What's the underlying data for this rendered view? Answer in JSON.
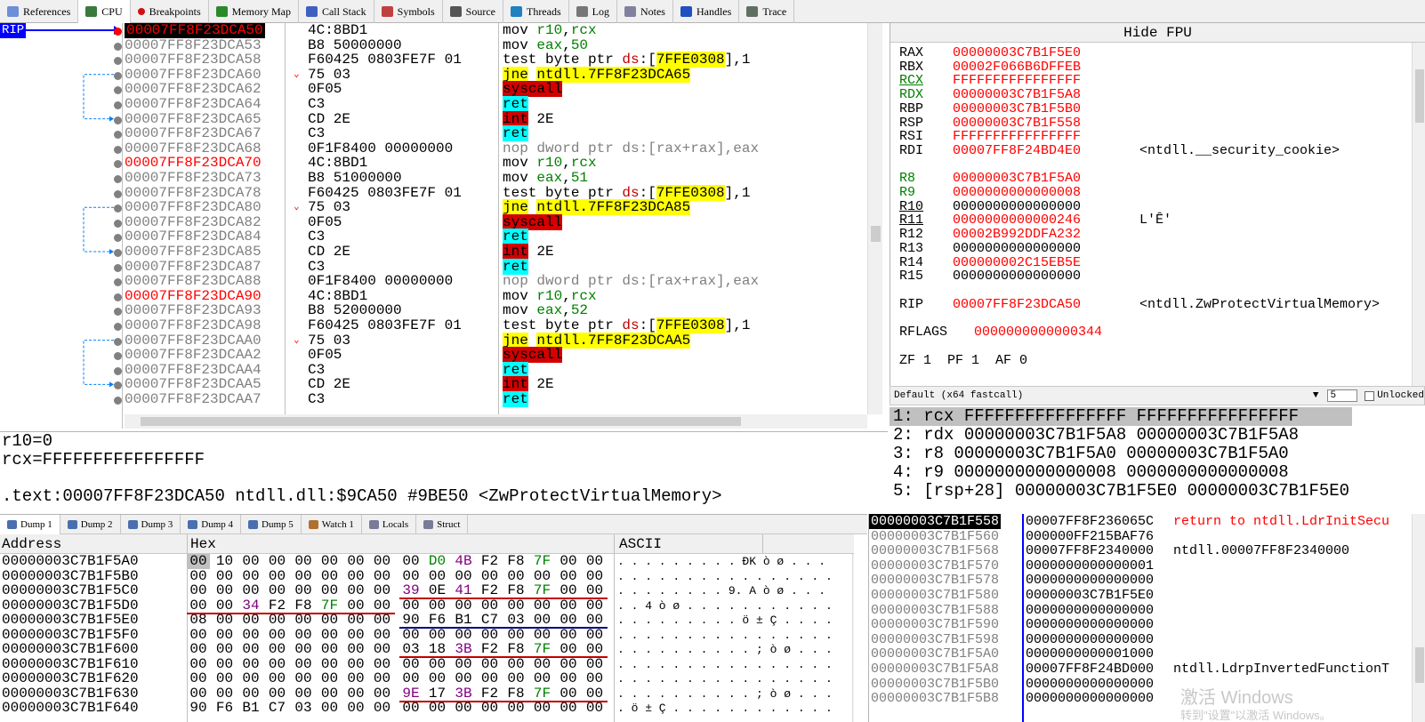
{
  "tabs": [
    {
      "label": "References",
      "icon": "search-icon"
    },
    {
      "label": "CPU",
      "icon": "cpu-icon"
    },
    {
      "label": "Breakpoints",
      "icon": "breakpoint-icon"
    },
    {
      "label": "Memory Map",
      "icon": "memory-icon"
    },
    {
      "label": "Call Stack",
      "icon": "stack-icon"
    },
    {
      "label": "Symbols",
      "icon": "symbols-icon"
    },
    {
      "label": "Source",
      "icon": "source-icon"
    },
    {
      "label": "Threads",
      "icon": "threads-icon"
    },
    {
      "label": "Log",
      "icon": "log-icon"
    },
    {
      "label": "Notes",
      "icon": "notes-icon"
    },
    {
      "label": "Handles",
      "icon": "handles-icon"
    },
    {
      "label": "Trace",
      "icon": "trace-icon"
    }
  ],
  "rip_label": "RIP",
  "disasm": [
    {
      "addr": "00007FF8F23DCA50",
      "bytes": "4C:8BD1",
      "instr": "mov r10,rcx",
      "style": "sel"
    },
    {
      "addr": "00007FF8F23DCA53",
      "bytes": "B8 50000000",
      "instr": "mov eax,50"
    },
    {
      "addr": "00007FF8F23DCA58",
      "bytes": "F60425 0803FE7F 01",
      "instr": "test byte ptr ds:[7FFE0308],1"
    },
    {
      "addr": "00007FF8F23DCA60",
      "bytes": "75 03",
      "instr": "jne ntdll.7FF8F23DCA65",
      "jmp": true
    },
    {
      "addr": "00007FF8F23DCA62",
      "bytes": "0F05",
      "instr": "syscall"
    },
    {
      "addr": "00007FF8F23DCA64",
      "bytes": "C3",
      "instr": "ret"
    },
    {
      "addr": "00007FF8F23DCA65",
      "bytes": "CD 2E",
      "instr": "int 2E"
    },
    {
      "addr": "00007FF8F23DCA67",
      "bytes": "C3",
      "instr": "ret"
    },
    {
      "addr": "00007FF8F23DCA68",
      "bytes": "0F1F8400 00000000",
      "instr": "nop dword ptr ds:[rax+rax],eax"
    },
    {
      "addr": "00007FF8F23DCA70",
      "bytes": "4C:8BD1",
      "instr": "mov r10,rcx",
      "style": "red"
    },
    {
      "addr": "00007FF8F23DCA73",
      "bytes": "B8 51000000",
      "instr": "mov eax,51"
    },
    {
      "addr": "00007FF8F23DCA78",
      "bytes": "F60425 0803FE7F 01",
      "instr": "test byte ptr ds:[7FFE0308],1"
    },
    {
      "addr": "00007FF8F23DCA80",
      "bytes": "75 03",
      "instr": "jne ntdll.7FF8F23DCA85",
      "jmp": true
    },
    {
      "addr": "00007FF8F23DCA82",
      "bytes": "0F05",
      "instr": "syscall"
    },
    {
      "addr": "00007FF8F23DCA84",
      "bytes": "C3",
      "instr": "ret"
    },
    {
      "addr": "00007FF8F23DCA85",
      "bytes": "CD 2E",
      "instr": "int 2E"
    },
    {
      "addr": "00007FF8F23DCA87",
      "bytes": "C3",
      "instr": "ret"
    },
    {
      "addr": "00007FF8F23DCA88",
      "bytes": "0F1F8400 00000000",
      "instr": "nop dword ptr ds:[rax+rax],eax"
    },
    {
      "addr": "00007FF8F23DCA90",
      "bytes": "4C:8BD1",
      "instr": "mov r10,rcx",
      "style": "red"
    },
    {
      "addr": "00007FF8F23DCA93",
      "bytes": "B8 52000000",
      "instr": "mov eax,52"
    },
    {
      "addr": "00007FF8F23DCA98",
      "bytes": "F60425 0803FE7F 01",
      "instr": "test byte ptr ds:[7FFE0308],1"
    },
    {
      "addr": "00007FF8F23DCAA0",
      "bytes": "75 03",
      "instr": "jne ntdll.7FF8F23DCAA5",
      "jmp": true
    },
    {
      "addr": "00007FF8F23DCAA2",
      "bytes": "0F05",
      "instr": "syscall"
    },
    {
      "addr": "00007FF8F23DCAA4",
      "bytes": "C3",
      "instr": "ret"
    },
    {
      "addr": "00007FF8F23DCAA5",
      "bytes": "CD 2E",
      "instr": "int 2E"
    },
    {
      "addr": "00007FF8F23DCAA7",
      "bytes": "C3",
      "instr": "ret"
    }
  ],
  "fpu_label": "Hide FPU",
  "registers": [
    {
      "name": "RAX",
      "value": "00000003C7B1F5E0"
    },
    {
      "name": "RBX",
      "value": "00002F066B6DFFEB"
    },
    {
      "name": "RCX",
      "value": "FFFFFFFFFFFFFFFF",
      "nameStyle": "green"
    },
    {
      "name": "RDX",
      "value": "00000003C7B1F5A8",
      "nameStyle": "green"
    },
    {
      "name": "RBP",
      "value": "00000003C7B1F5B0"
    },
    {
      "name": "RSP",
      "value": "00000003C7B1F558"
    },
    {
      "name": "RSI",
      "value": "FFFFFFFFFFFFFFFF"
    },
    {
      "name": "RDI",
      "value": "00007FF8F24BD4E0",
      "comment": "<ntdll.__security_cookie>"
    },
    {
      "name": "",
      "value": ""
    },
    {
      "name": "R8",
      "value": "00000003C7B1F5A0",
      "nameStyle": "green"
    },
    {
      "name": "R9",
      "value": "0000000000000008",
      "nameStyle": "green"
    },
    {
      "name": "R10",
      "value": "0000000000000000",
      "valueStyle": "black",
      "nameStyle": "under"
    },
    {
      "name": "R11",
      "value": "0000000000000246",
      "comment": "L'Ȇ'",
      "nameStyle": "under"
    },
    {
      "name": "R12",
      "value": "00002B992DDFA232"
    },
    {
      "name": "R13",
      "value": "0000000000000000",
      "valueStyle": "black"
    },
    {
      "name": "R14",
      "value": "000000002C15EB5E"
    },
    {
      "name": "R15",
      "value": "0000000000000000",
      "valueStyle": "black"
    },
    {
      "name": "",
      "value": ""
    },
    {
      "name": "RIP",
      "value": "00007FF8F23DCA50",
      "comment": "<ntdll.ZwProtectVirtualMemory>"
    },
    {
      "name": "",
      "value": ""
    },
    {
      "name": "RFLAGS",
      "value": "0000000000000344"
    }
  ],
  "flags": "ZF 1  PF 1  AF 0",
  "callconv": "Default (x64 fastcall)",
  "argcount": "5",
  "unlocked_label": "Unlocked",
  "args": [
    "1: rcx FFFFFFFFFFFFFFFF FFFFFFFFFFFFFFFF",
    "2: rdx 00000003C7B1F5A8 00000003C7B1F5A8",
    "3: r8 00000003C7B1F5A0 00000003C7B1F5A0",
    "4: r9 0000000000000008 0000000000000008",
    "5: [rsp+28] 00000003C7B1F5E0 00000003C7B1F5E0"
  ],
  "info": [
    "r10=0",
    "rcx=FFFFFFFFFFFFFFFF",
    "",
    ".text:00007FF8F23DCA50 ntdll.dll:$9CA50 #9BE50 <ZwProtectVirtualMemory>"
  ],
  "dump_tabs": [
    "Dump 1",
    "Dump 2",
    "Dump 3",
    "Dump 4",
    "Dump 5",
    "Watch 1",
    "Locals",
    "Struct"
  ],
  "dump_headers": {
    "address": "Address",
    "hex": "Hex",
    "ascii": "ASCII"
  },
  "dump": [
    {
      "addr": "00000003C7B1F5A0",
      "hex": [
        "00",
        "10",
        "00",
        "00",
        "00",
        "00",
        "00",
        "00",
        "00",
        "D0",
        "4B",
        "F2",
        "F8",
        "7F",
        "00",
        "00"
      ],
      "ascii": ". . . . . . . . . ÐK ò ø . . ."
    },
    {
      "addr": "00000003C7B1F5B0",
      "hex": [
        "00",
        "00",
        "00",
        "00",
        "00",
        "00",
        "00",
        "00",
        "00",
        "00",
        "00",
        "00",
        "00",
        "00",
        "00",
        "00"
      ],
      "ascii": ". . . . . . . . . . . . . . . ."
    },
    {
      "addr": "00000003C7B1F5C0",
      "hex": [
        "00",
        "00",
        "00",
        "00",
        "00",
        "00",
        "00",
        "00",
        "39",
        "0E",
        "41",
        "F2",
        "F8",
        "7F",
        "00",
        "00"
      ],
      "ascii": ". . . . . . . . 9. A ò ø . . ."
    },
    {
      "addr": "00000003C7B1F5D0",
      "hex": [
        "00",
        "00",
        "34",
        "F2",
        "F8",
        "7F",
        "00",
        "00",
        "00",
        "00",
        "00",
        "00",
        "00",
        "00",
        "00",
        "00"
      ],
      "ascii": ". . 4 ò ø . . . . . . . . . . ."
    },
    {
      "addr": "00000003C7B1F5E0",
      "hex": [
        "08",
        "00",
        "00",
        "00",
        "00",
        "00",
        "00",
        "00",
        "90",
        "F6",
        "B1",
        "C7",
        "03",
        "00",
        "00",
        "00"
      ],
      "ascii": ". . . . . . . . . ö ± Ç . . . ."
    },
    {
      "addr": "00000003C7B1F5F0",
      "hex": [
        "00",
        "00",
        "00",
        "00",
        "00",
        "00",
        "00",
        "00",
        "00",
        "00",
        "00",
        "00",
        "00",
        "00",
        "00",
        "00"
      ],
      "ascii": ". . . . . . . . . . . . . . . ."
    },
    {
      "addr": "00000003C7B1F600",
      "hex": [
        "00",
        "00",
        "00",
        "00",
        "00",
        "00",
        "00",
        "00",
        "03",
        "18",
        "3B",
        "F2",
        "F8",
        "7F",
        "00",
        "00"
      ],
      "ascii": ". . . . . . . . . . ; ò ø . . ."
    },
    {
      "addr": "00000003C7B1F610",
      "hex": [
        "00",
        "00",
        "00",
        "00",
        "00",
        "00",
        "00",
        "00",
        "00",
        "00",
        "00",
        "00",
        "00",
        "00",
        "00",
        "00"
      ],
      "ascii": ". . . . . . . . . . . . . . . ."
    },
    {
      "addr": "00000003C7B1F620",
      "hex": [
        "00",
        "00",
        "00",
        "00",
        "00",
        "00",
        "00",
        "00",
        "00",
        "00",
        "00",
        "00",
        "00",
        "00",
        "00",
        "00"
      ],
      "ascii": ". . . . . . . . . . . . . . . ."
    },
    {
      "addr": "00000003C7B1F630",
      "hex": [
        "00",
        "00",
        "00",
        "00",
        "00",
        "00",
        "00",
        "00",
        "9E",
        "17",
        "3B",
        "F2",
        "F8",
        "7F",
        "00",
        "00"
      ],
      "ascii": ". . . . . . . . . . ; ò ø . . ."
    },
    {
      "addr": "00000003C7B1F640",
      "hex": [
        "90",
        "F6",
        "B1",
        "C7",
        "03",
        "00",
        "00",
        "00",
        "00",
        "00",
        "00",
        "00",
        "00",
        "00",
        "00",
        "00"
      ],
      "ascii": ". ö ± Ç . . . . . . . . . . . ."
    }
  ],
  "stack": [
    {
      "addr": "00000003C7B1F558",
      "value": "00007FF8F236065C",
      "comment": "return to ntdll.LdrInitSecu",
      "sel": true
    },
    {
      "addr": "00000003C7B1F560",
      "value": "000000FF215BAF76",
      "comment": ""
    },
    {
      "addr": "00000003C7B1F568",
      "value": "00007FF8F2340000",
      "comment": "ntdll.00007FF8F2340000"
    },
    {
      "addr": "00000003C7B1F570",
      "value": "0000000000000001",
      "comment": ""
    },
    {
      "addr": "00000003C7B1F578",
      "value": "0000000000000000",
      "comment": ""
    },
    {
      "addr": "00000003C7B1F580",
      "value": "00000003C7B1F5E0",
      "comment": ""
    },
    {
      "addr": "00000003C7B1F588",
      "value": "0000000000000000",
      "comment": ""
    },
    {
      "addr": "00000003C7B1F590",
      "value": "0000000000000000",
      "comment": ""
    },
    {
      "addr": "00000003C7B1F598",
      "value": "0000000000000000",
      "comment": ""
    },
    {
      "addr": "00000003C7B1F5A0",
      "value": "0000000000001000",
      "comment": ""
    },
    {
      "addr": "00000003C7B1F5A8",
      "value": "00007FF8F24BD000",
      "comment": "ntdll.LdrpInvertedFunctionT"
    },
    {
      "addr": "00000003C7B1F5B0",
      "value": "0000000000000000",
      "comment": ""
    },
    {
      "addr": "00000003C7B1F5B8",
      "value": "0000000000000000",
      "comment": ""
    }
  ],
  "watermark": {
    "line1": "激活 Windows",
    "line2": "转到\"设置\"以激活 Windows。"
  },
  "colors": {
    "yellow": "#ffff00",
    "red_block": "#d20000",
    "cyan": "#00ffff",
    "addr_red": "#ff0000"
  }
}
